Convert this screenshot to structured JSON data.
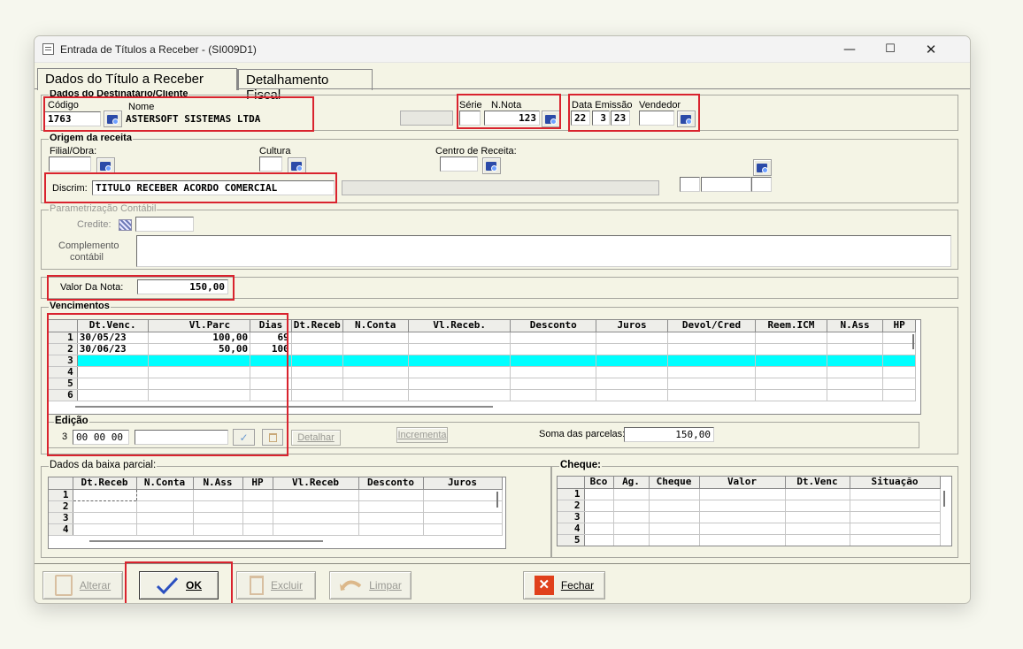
{
  "window": {
    "title": "Entrada de Títulos a Receber - (SI009D1)",
    "minimize": "—",
    "maximize": "☐",
    "close": "✕"
  },
  "tabs": [
    {
      "label": "Dados do Título a Receber"
    },
    {
      "label": "Detalhamento Fiscal"
    }
  ],
  "destinatario": {
    "legend": "Dados do Destinatário/Cliente",
    "codigo_label": "Código",
    "codigo": "1763",
    "nome_label": "Nome",
    "nome": "ASTERSOFT SISTEMAS LTDA",
    "serie_label": "Série",
    "serie": "",
    "nnota_label": "N.Nota",
    "nnota": "123",
    "data_label": "Data Emissão",
    "data_d": "22",
    "data_m": "3",
    "data_y": "23",
    "vendedor_label": "Vendedor",
    "vendedor": ""
  },
  "origem": {
    "legend": "Origem da receita",
    "filial_label": "Filial/Obra:",
    "cultura_label": "Cultura",
    "centro_label": "Centro de Receita:",
    "discrim_label": "Discrim:",
    "discrim": "TITULO RECEBER ACORDO COMERCIAL"
  },
  "param": {
    "legend": "Parametrização Contábil",
    "credite_label": "Credite:",
    "complemento_label": "Complemento contábil"
  },
  "valor": {
    "label": "Valor Da Nota:",
    "value": "150,00"
  },
  "vencimentos": {
    "legend": "Vencimentos",
    "columns": [
      "Dt.Venc.",
      "Vl.Parc",
      "Dias",
      "Dt.Receb",
      "N.Conta",
      "Vl.Receb.",
      "Desconto",
      "Juros",
      "Devol/Cred",
      "Reem.ICM",
      "N.Ass",
      "HP"
    ],
    "rows": [
      {
        "n": "1",
        "dtvenc": "30/05/23",
        "vlparc": "100,00",
        "dias": "69"
      },
      {
        "n": "2",
        "dtvenc": "30/06/23",
        "vlparc": "50,00",
        "dias": "100"
      },
      {
        "n": "3",
        "dtvenc": "",
        "vlparc": "",
        "dias": ""
      },
      {
        "n": "4",
        "dtvenc": "",
        "vlparc": "",
        "dias": ""
      },
      {
        "n": "5",
        "dtvenc": "",
        "vlparc": "",
        "dias": ""
      },
      {
        "n": "6",
        "dtvenc": "",
        "vlparc": "",
        "dias": ""
      }
    ]
  },
  "edicao": {
    "legend": "Edição",
    "row": "3",
    "date": "00 00 00",
    "detalhar": "Detalhar",
    "incrementa": "Incrementa",
    "soma_label": "Soma das parcelas:",
    "soma": "150,00"
  },
  "baixa": {
    "legend": "Dados da baixa parcial:",
    "columns": [
      "Dt.Receb",
      "N.Conta",
      "N.Ass",
      "HP",
      "Vl.Receb",
      "Desconto",
      "Juros"
    ],
    "rows": [
      "1",
      "2",
      "3",
      "4"
    ]
  },
  "cheque": {
    "legend": "Cheque:",
    "columns": [
      "Bco",
      "Ag.",
      "Cheque",
      "Valor",
      "Dt.Venc",
      "Situação"
    ],
    "rows": [
      "1",
      "2",
      "3",
      "4",
      "5"
    ]
  },
  "buttons": {
    "alterar": "Alterar",
    "ok": "OK",
    "excluir": "Excluir",
    "limpar": "Limpar",
    "fechar": "Fechar"
  },
  "colors": {
    "accent_red": "#d9232e",
    "selection": "#00ffff",
    "lookup_blue": "#2b4aa8"
  }
}
